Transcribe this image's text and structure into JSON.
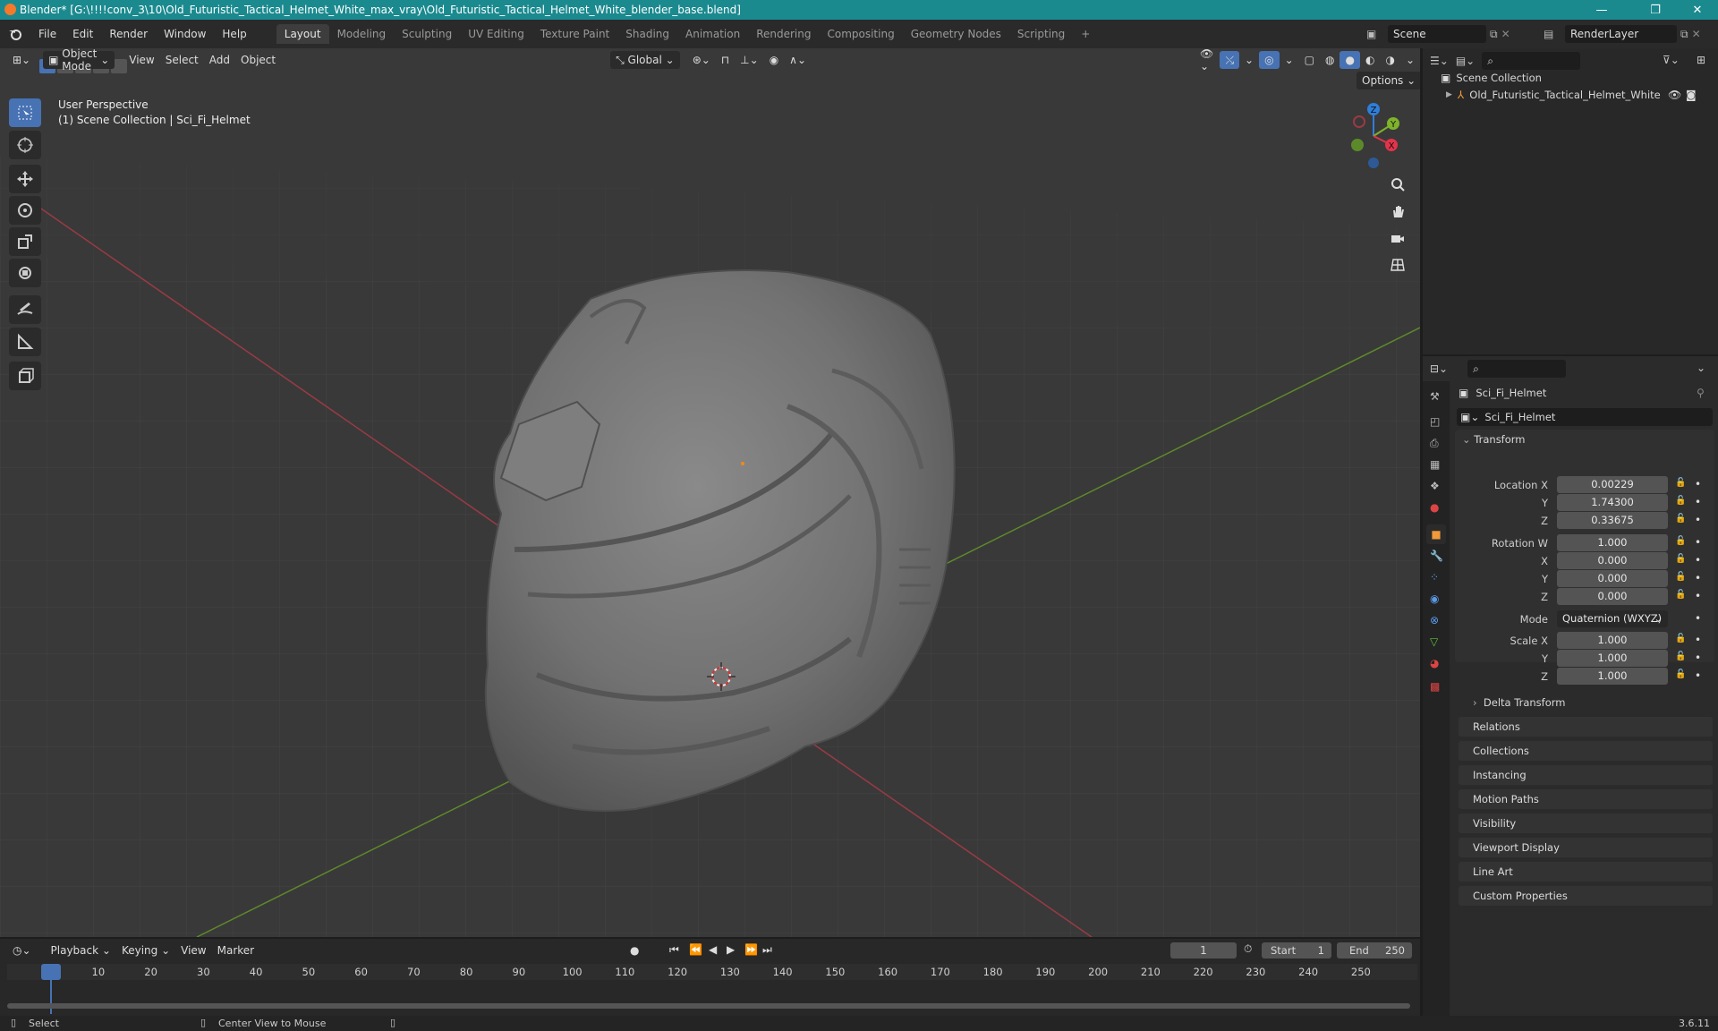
{
  "window": {
    "title": "Blender* [G:\\!!!!conv_3\\10\\Old_Futuristic_Tactical_Helmet_White_max_vray\\Old_Futuristic_Tactical_Helmet_White_blender_base.blend]",
    "minimize": "—",
    "maximize": "❐",
    "close": "✕"
  },
  "menu": [
    "File",
    "Edit",
    "Render",
    "Window",
    "Help"
  ],
  "workspaces": [
    "Layout",
    "Modeling",
    "Sculpting",
    "UV Editing",
    "Texture Paint",
    "Shading",
    "Animation",
    "Rendering",
    "Compositing",
    "Geometry Nodes",
    "Scripting"
  ],
  "add_workspace": "+",
  "scene": {
    "name": "Scene",
    "render_layer": "RenderLayer"
  },
  "viewport": {
    "mode": "Object Mode",
    "menus": [
      "View",
      "Select",
      "Add",
      "Object"
    ],
    "orientation": "Global",
    "options_label": "Options",
    "overlay_line1": "User Perspective",
    "overlay_line2": "(1) Scene Collection | Sci_Fi_Helmet",
    "gizmo": {
      "z": "Z",
      "y": "Y",
      "x": "X"
    }
  },
  "outliner": {
    "scene_collection": "Scene Collection",
    "object": "Old_Futuristic_Tactical_Helmet_White"
  },
  "properties": {
    "object_name": "Sci_Fi_Helmet",
    "data_name": "Sci_Fi_Helmet",
    "transform_label": "Transform",
    "location": {
      "label_x": "Location X",
      "label_y": "Y",
      "label_z": "Z",
      "x": "0.00229",
      "y": "1.74300",
      "z": "0.33675"
    },
    "rotation": {
      "label_w": "Rotation W",
      "label_x": "X",
      "label_y": "Y",
      "label_z": "Z",
      "w": "1.000",
      "x": "0.000",
      "y": "0.000",
      "z": "0.000"
    },
    "mode_label": "Mode",
    "mode_value": "Quaternion (WXYZ)",
    "scale": {
      "label_x": "Scale X",
      "label_y": "Y",
      "label_z": "Z",
      "x": "1.000",
      "y": "1.000",
      "z": "1.000"
    },
    "delta_transform": "Delta Transform",
    "panels": [
      "Relations",
      "Collections",
      "Instancing",
      "Motion Paths",
      "Visibility",
      "Viewport Display",
      "Line Art",
      "Custom Properties"
    ]
  },
  "timeline": {
    "menus": [
      "Playback",
      "Keying",
      "View",
      "Marker"
    ],
    "current_frame": "1",
    "start_label": "Start",
    "start": "1",
    "end_label": "End",
    "end": "250",
    "ticks": [
      "1",
      "10",
      "20",
      "30",
      "40",
      "50",
      "60",
      "70",
      "80",
      "90",
      "100",
      "110",
      "120",
      "130",
      "140",
      "150",
      "160",
      "170",
      "180",
      "190",
      "200",
      "210",
      "220",
      "230",
      "240",
      "250"
    ]
  },
  "status": {
    "select": "Select",
    "center": "Center View to Mouse",
    "version": "3.6.11"
  },
  "colors": {
    "accent": "#4772b3",
    "title_bar": "#1b8a8f",
    "axis_x": "#e3334a",
    "axis_y": "#7fb32b",
    "axis_z": "#2f7ed8"
  }
}
